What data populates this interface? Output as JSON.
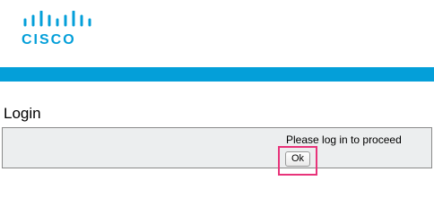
{
  "header": {
    "logo_text": "cisco",
    "brand_color": "#049fd9"
  },
  "login": {
    "title": "Login",
    "message": "Please log in to proceed",
    "ok_label": "Ok",
    "highlight_color": "#e8337a"
  }
}
